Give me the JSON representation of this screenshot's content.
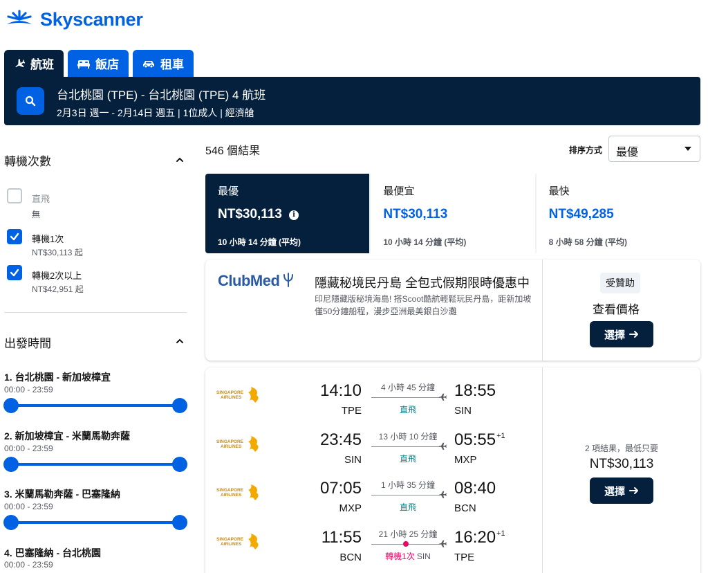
{
  "brand": {
    "name": "Skyscanner",
    "color": "#0062e3"
  },
  "tabs": [
    {
      "label": "航班",
      "icon": "plane-icon",
      "active": true
    },
    {
      "label": "飯店",
      "icon": "bed-icon",
      "active": false
    },
    {
      "label": "租車",
      "icon": "car-icon",
      "active": false
    }
  ],
  "search": {
    "route": "台北桃園 (TPE) - 台北桃園 (TPE) 4 航班",
    "details": "2月3日 週一 - 2月14日 週五 | 1位成人 | 經濟艙"
  },
  "filters": {
    "stops": {
      "title": "轉機次數",
      "options": [
        {
          "label": "直飛",
          "sub": "無",
          "checked": false
        },
        {
          "label": "轉機1次",
          "sub": "NT$30,113 起",
          "checked": true
        },
        {
          "label": "轉機2次以上",
          "sub": "NT$42,951 起",
          "checked": true
        }
      ]
    },
    "departure": {
      "title": "出發時間",
      "legs": [
        {
          "title": "1. 台北桃園 - 新加坡樟宜",
          "range": "00:00 - 23:59"
        },
        {
          "title": "2. 新加坡樟宜 - 米蘭馬勒奔薩",
          "range": "00:00 - 23:59"
        },
        {
          "title": "3. 米蘭馬勒奔薩 - 巴塞隆納",
          "range": "00:00 - 23:59"
        },
        {
          "title": "4. 巴塞隆納 - 台北桃園",
          "range": "00:00 - 23:59"
        }
      ]
    }
  },
  "results": {
    "count": "546 個結果",
    "sort_label": "排序方式",
    "sort_value": "最優",
    "sort_tabs": [
      {
        "title": "最優",
        "price": "NT$30,113",
        "duration": "10 小時 14 分鐘 (平均)",
        "active": true
      },
      {
        "title": "最便宜",
        "price": "NT$30,113",
        "duration": "10 小時 14 分鐘 (平均)",
        "active": false
      },
      {
        "title": "最快",
        "price": "NT$49,285",
        "duration": "8 小時 58 分鐘 (平均)",
        "active": false
      }
    ]
  },
  "ad": {
    "brand": "ClubMed",
    "title": "隱藏秘境民丹島 全包式假期限時優惠中",
    "description": "印尼隱藏版秘境海島! 搭Scoot酷航輕鬆玩民丹島，距新加坡僅50分鐘船程，漫步亞洲最美銀白沙灘",
    "badge": "受贊助",
    "view": "查看價格",
    "button": "選擇"
  },
  "itinerary": {
    "airline": "SINGAPORE AIRLINES",
    "legs": [
      {
        "dep_time": "14:10",
        "dep_code": "TPE",
        "duration": "4 小時 45 分鐘",
        "stops": "直飛",
        "via": "",
        "arr_time": "18:55",
        "arr_plus": "",
        "arr_code": "SIN"
      },
      {
        "dep_time": "23:45",
        "dep_code": "SIN",
        "duration": "13 小時 10 分鐘",
        "stops": "直飛",
        "via": "",
        "arr_time": "05:55",
        "arr_plus": "+1",
        "arr_code": "MXP"
      },
      {
        "dep_time": "07:05",
        "dep_code": "MXP",
        "duration": "1 小時 35 分鐘",
        "stops": "直飛",
        "via": "",
        "arr_time": "08:40",
        "arr_plus": "",
        "arr_code": "BCN"
      },
      {
        "dep_time": "11:55",
        "dep_code": "BCN",
        "duration": "21 小時 25 分鐘",
        "stops": "轉機1次",
        "via": "SIN",
        "arr_time": "16:20",
        "arr_plus": "+1",
        "arr_code": "TPE"
      }
    ],
    "price_note": "2 項結果，最低只要",
    "price": "NT$30,113",
    "button": "選擇"
  },
  "colors": {
    "navy": "#05203c",
    "blue": "#0062e3",
    "stop_red": "#e70866",
    "direct_teal": "#0c838a"
  }
}
